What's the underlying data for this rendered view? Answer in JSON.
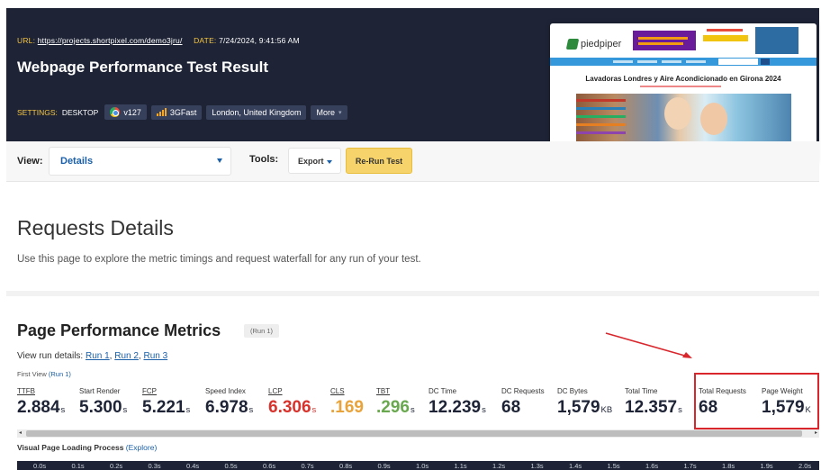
{
  "header": {
    "url_label": "URL:",
    "url": "https://projects.shortpixel.com/demo3jru/",
    "date_label": "DATE:",
    "date": "7/24/2024, 9:41:56 AM",
    "title": "Webpage Performance Test Result",
    "settings_label": "SETTINGS:",
    "device": "DESKTOP",
    "browser_version": "v127",
    "connection": "3GFast",
    "location": "London, United Kingdom",
    "more_label": "More"
  },
  "thumbnail": {
    "brand": "piedpiper",
    "heading": "Lavadoras Londres y Aire Acondicionado en Girona 2024"
  },
  "toolbar": {
    "view_label": "View:",
    "view_value": "Details",
    "tools_label": "Tools:",
    "export_label": "Export",
    "rerun_label": "Re-Run Test"
  },
  "requests_details": {
    "title": "Requests Details",
    "description": "Use this page to explore the metric timings and request waterfall for any run of your test."
  },
  "performance": {
    "title": "Page Performance Metrics",
    "run_badge": "(Run 1)",
    "view_run_label": "View run details:",
    "runs": [
      "Run 1",
      "Run 2",
      "Run 3"
    ],
    "first_view_label": "First View",
    "first_view_run": "(Run 1)",
    "metrics": [
      {
        "label": "TTFB",
        "value": "2.884",
        "unit": "s"
      },
      {
        "label": "Start Render",
        "value": "5.300",
        "unit": "s"
      },
      {
        "label": "FCP",
        "value": "5.221",
        "unit": "s"
      },
      {
        "label": "Speed Index",
        "value": "6.978",
        "unit": "s"
      },
      {
        "label": "LCP",
        "value": "6.306",
        "unit": "s"
      },
      {
        "label": "CLS",
        "value": ".169",
        "unit": ""
      },
      {
        "label": "TBT",
        "value": ".296",
        "unit": "s"
      },
      {
        "label": "DC Time",
        "value": "12.239",
        "unit": "s"
      },
      {
        "label": "DC Requests",
        "value": "68",
        "unit": ""
      },
      {
        "label": "DC Bytes",
        "value": "1,579",
        "unit": "KB"
      },
      {
        "label": "Total Time",
        "value": "12.357",
        "unit": "s"
      },
      {
        "label": "Total Requests",
        "value": "68",
        "unit": ""
      },
      {
        "label": "Page Weight",
        "value": "1,579",
        "unit": "K"
      }
    ],
    "colors": {
      "lcp": "#d8322c",
      "cls": "#e8a33b",
      "tbt": "#6aa84f",
      "default": "#1e2436",
      "highlight": "#d8262c"
    }
  },
  "visual_loading": {
    "label": "Visual Page Loading Process",
    "explore_label": "(Explore)",
    "ticks": [
      "0.0s",
      "0.1s",
      "0.2s",
      "0.3s",
      "0.4s",
      "0.5s",
      "0.6s",
      "0.7s",
      "0.8s",
      "0.9s",
      "1.0s",
      "1.1s",
      "1.2s",
      "1.3s",
      "1.4s",
      "1.5s",
      "1.6s",
      "1.7s",
      "1.8s",
      "1.9s",
      "2.0s"
    ]
  }
}
